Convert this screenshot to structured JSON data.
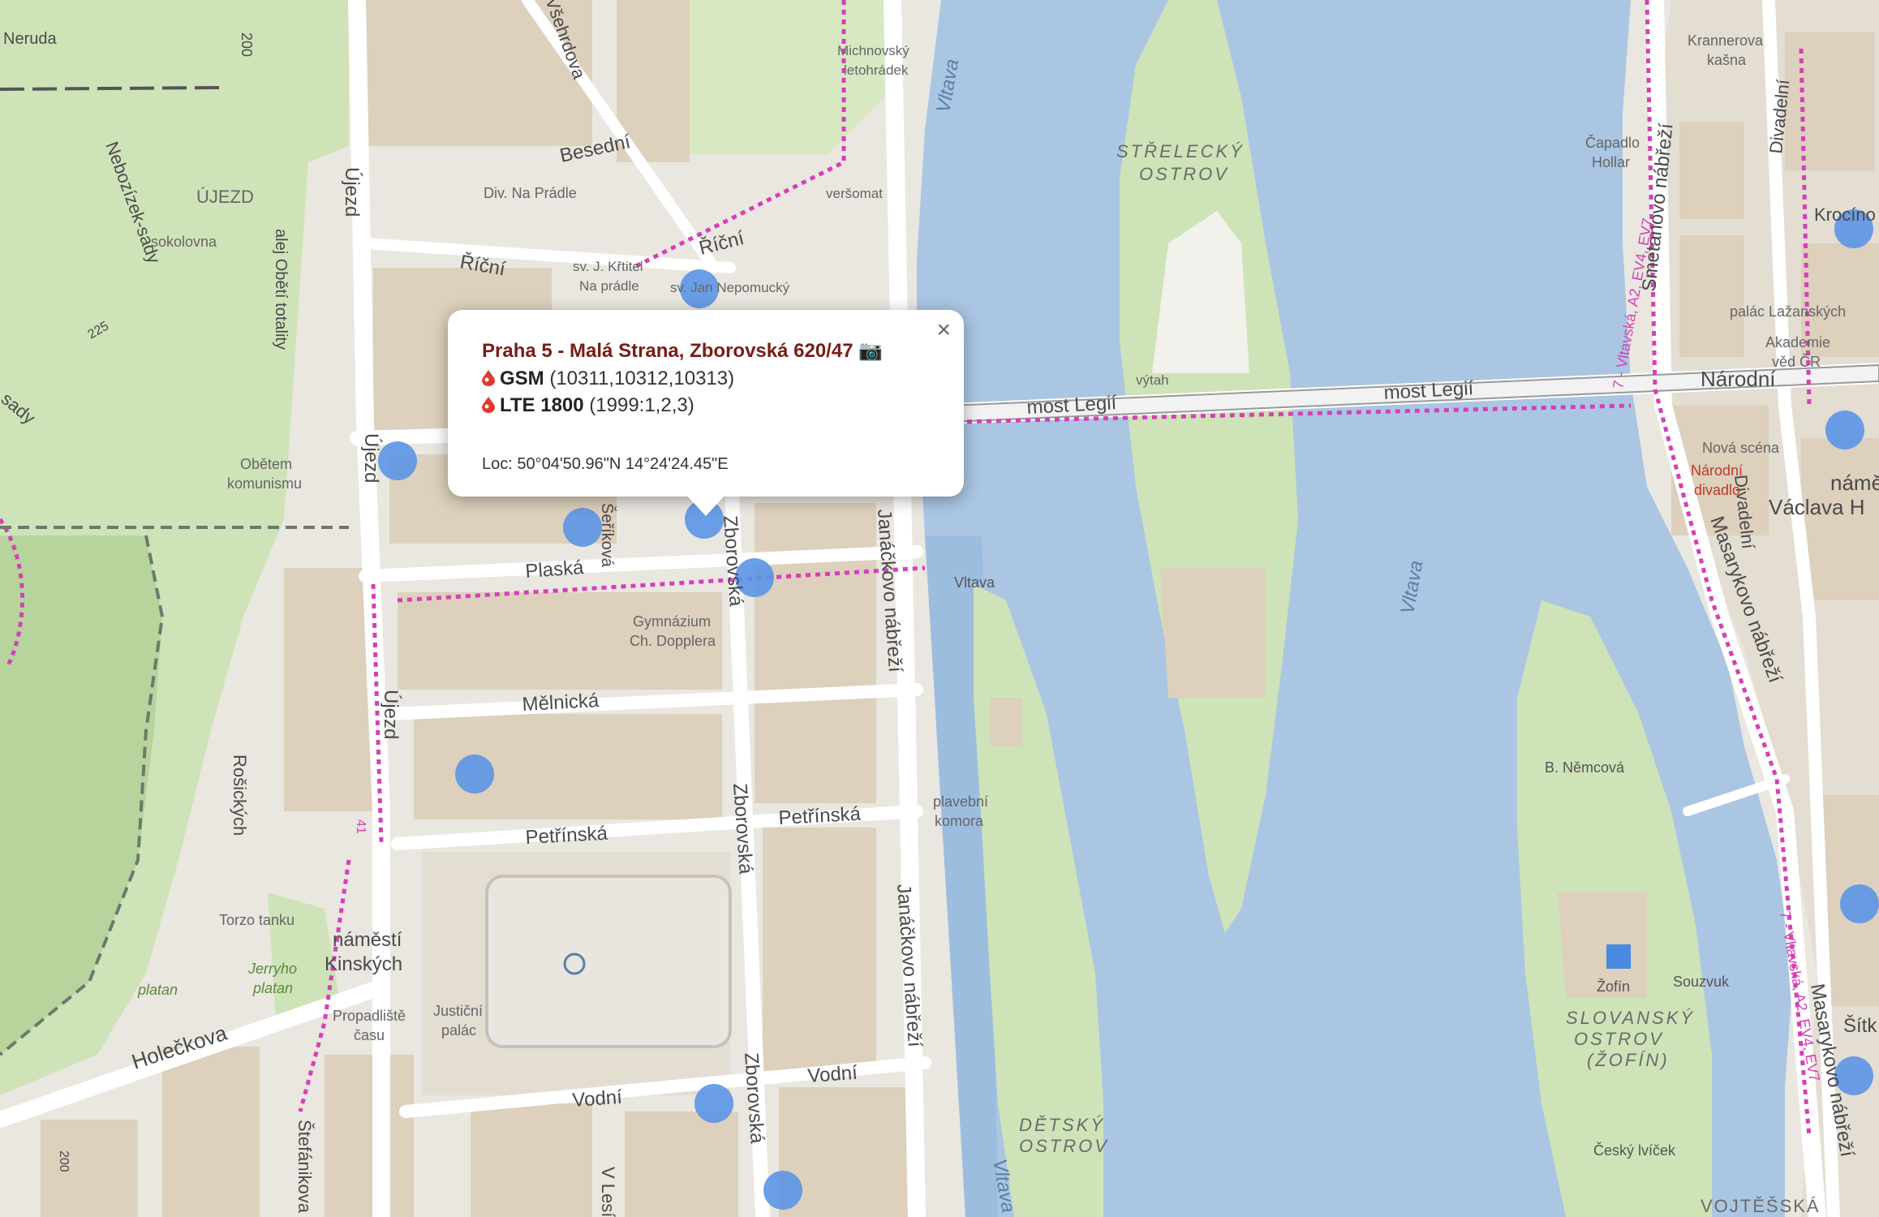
{
  "popup": {
    "title": "Praha 5 - Malá Strana, Zborovská 620/47",
    "camera_icon": "📷",
    "close_symbol": "×",
    "tech": [
      {
        "name": "GSM",
        "values": "(10311,10312,10313)",
        "icon": "vodafone-drop-icon"
      },
      {
        "name": "LTE 1800",
        "values": "(1999:1,2,3)",
        "icon": "vodafone-drop-icon"
      }
    ],
    "location": "Loc: 50°04'50.96\"N 14°24'24.45\"E"
  },
  "colors": {
    "water": "#aac6e3",
    "park": "#cfe3b8",
    "building": "#ddd0bd",
    "road": "#ffffff",
    "marker": "#5b95e6",
    "bike_route": "#d63fb8",
    "popup_title": "#7a1c17"
  },
  "map_labels": {
    "neruda": "Neruda",
    "n200a": "200",
    "ujezd_district": "ÚJEZD",
    "sokolovna": "sokolovna",
    "nebozizek": "Nebozízek-sady",
    "n225": "225",
    "alej": "alej Obětí totality",
    "sady": "sady",
    "obetem1": "Obětem",
    "obetem2": "komunismu",
    "ujezd1": "Újezd",
    "ujezd2": "Újezd",
    "ujezd3": "Újezd",
    "div_na_pradle": "Div. Na Prádle",
    "besedni": "Besední",
    "ricni1": "Říční",
    "ricni2": "Říční",
    "kritel1": "sv. J. Křtitel",
    "kritel2": "Na prádle",
    "nepomucky": "sv. Jan Nepomucký",
    "vsehrdova": "Všehrdova",
    "michnovsky1": "Michnovský",
    "michnovsky2": "letohrádek",
    "versomat": "veršomat",
    "plaska": "Plaská",
    "sefrikova": "Šeříková",
    "zborovska1": "Zborovská",
    "zborovska2": "Zborovská",
    "zborovska3": "Zborovská",
    "gymnazium1": "Gymnázium",
    "gymnazium2": "Ch. Dopplera",
    "melnicka": "Mělnická",
    "petrinska1": "Petřínská",
    "petrinska2": "Petřínská",
    "vodni1": "Vodní",
    "vodni2": "Vodní",
    "janackovo1": "Janáčkovo nábřeží",
    "janackovo2": "Janáčkovo nábřeží",
    "vltava_river1": "Vltava",
    "vltava_river2": "Vltava",
    "vltava_river3": "Vltava",
    "vltava_station": "Vltava",
    "plavebni1": "plavební",
    "plavebni2": "komora",
    "strelecky1": "STŘELECKÝ",
    "strelecky2": "OSTROV",
    "vytah": "výtah",
    "most_legii1": "most Legií",
    "most_legii2": "most Legií",
    "detsky1": "DĚTSKÝ",
    "detsky2": "OSTROV",
    "slovansky1": "SLOVANSKÝ",
    "slovansky2": "OSTROV",
    "slovansky3": "(ŽOFÍN)",
    "nemcova": "B. Němcová",
    "zofin": "Žofín",
    "souzvuk": "Souzvuk",
    "cesky_ivicek": "Český lvíček",
    "roscickych": "Rošických",
    "torzo": "Torzo tanku",
    "kinskych1": "náměstí",
    "kinskych2": "Kinských",
    "jerryho1": "Jerryho",
    "jerryho2": "platan",
    "platan": "platan",
    "propadliste1": "Propadliště",
    "propadliste2": "času",
    "justicni1": "Justiční",
    "justicni2": "palác",
    "holeckova": "Holečkova",
    "stefanikova": "Štefánikova",
    "v_lesicku": "V Lesíčku",
    "krannerova1": "Krannerova",
    "krannerova2": "kašna",
    "capadlo1": "Čapadlo",
    "capadlo2": "Hollar",
    "smetanovo": "Smetanovo nábřeží",
    "divadelni1": "Divadelní",
    "divadelni2": "Divadelní",
    "krocino": "Krocíno",
    "lazanskych": "palác Lažanských",
    "akademie1": "Akademie",
    "akademie2": "věd ČR",
    "narodni": "Národní",
    "nova_scena": "Nová scéna",
    "narodni_divadlo1": "Národní",
    "narodni_divadlo2": "divadlo",
    "namesti_vh1": "náměs",
    "namesti_vh2": "Václava H",
    "masarykovo1": "Masarykovo nábřeží",
    "masarykovo2": "Masarykovo nábřeží",
    "vltavska1": "7 - Vltavská, A2, EV4, EV7",
    "vltavska2": "7 - Vltavská, A2, EV4, EV7",
    "sitk": "Šítk",
    "vojtesska": "VOJTĚŠSKÁ",
    "n200b": "200",
    "n41": "41"
  }
}
